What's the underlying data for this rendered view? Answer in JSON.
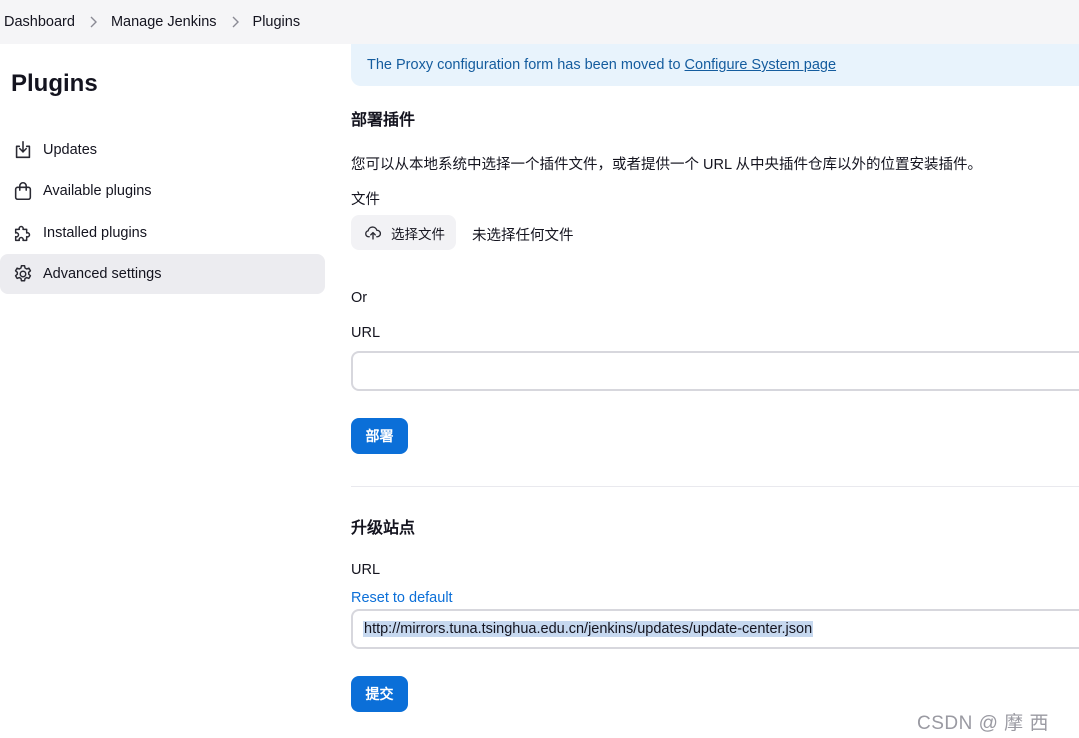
{
  "breadcrumb": {
    "items": [
      "Dashboard",
      "Manage Jenkins",
      "Plugins"
    ]
  },
  "sidebar": {
    "title": "Plugins",
    "items": [
      {
        "label": "Updates",
        "icon": "download-icon"
      },
      {
        "label": "Available plugins",
        "icon": "shopping-bag-icon"
      },
      {
        "label": "Installed plugins",
        "icon": "puzzle-icon"
      },
      {
        "label": "Advanced settings",
        "icon": "gear-icon",
        "active": true
      }
    ]
  },
  "notice": {
    "text": "The Proxy configuration form has been moved to",
    "link": "Configure System page"
  },
  "deploy": {
    "heading": "部署插件",
    "description": "您可以从本地系统中选择一个插件文件，或者提供一个 URL 从中央插件仓库以外的位置安装插件。",
    "file_label": "文件",
    "choose_file": "选择文件",
    "no_file": "未选择任何文件",
    "or": "Or",
    "url_label": "URL",
    "url_value": "",
    "submit": "部署"
  },
  "update_site": {
    "heading": "升级站点",
    "url_label": "URL",
    "reset_link": "Reset to default",
    "url_value": "http://mirrors.tuna.tsinghua.edu.cn/jenkins/updates/update-center.json",
    "submit": "提交"
  },
  "watermark": "CSDN @ 摩 西",
  "colors": {
    "primary": "#0b6fd8",
    "notice_bg": "#e8f3fc",
    "notice_text": "#145c9e",
    "active_nav_bg": "#ececf0"
  }
}
